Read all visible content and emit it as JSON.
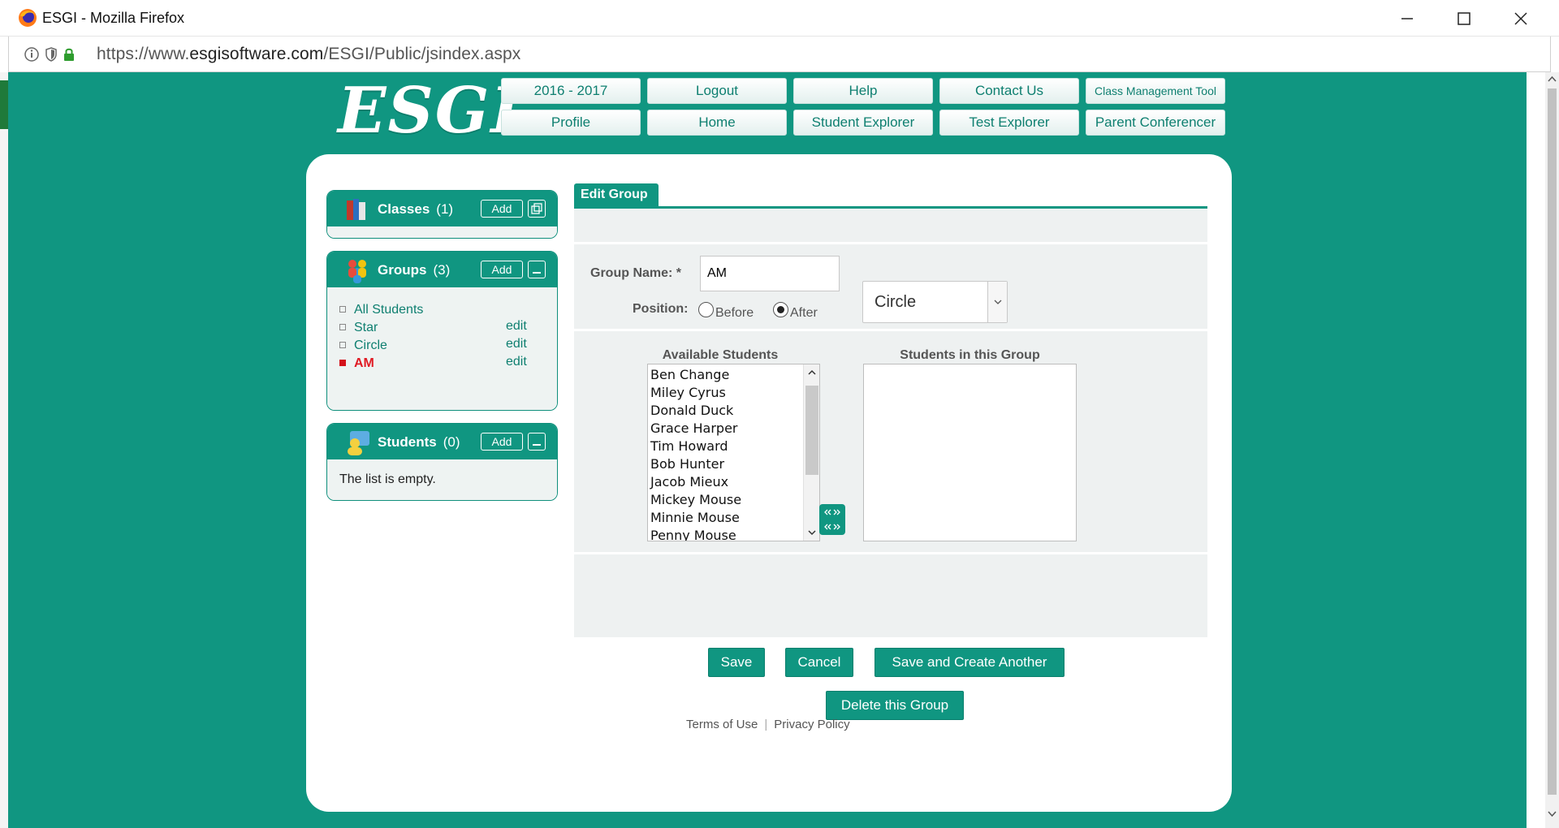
{
  "window": {
    "title": "ESGI - Mozilla Firefox",
    "url_prefix": "https://www.",
    "url_host": "esgisoftware.com",
    "url_path": "/ESGI/Public/jsindex.aspx"
  },
  "brand": {
    "logo_text": "ESGI"
  },
  "nav": {
    "row1": [
      "2016 - 2017",
      "Logout",
      "Help",
      "Contact Us",
      "Class Management Tool"
    ],
    "row2": [
      "Profile",
      "Home",
      "Student Explorer",
      "Test Explorer",
      "Parent Conferencer"
    ]
  },
  "sidebar": {
    "classes": {
      "title": "Classes",
      "count": "(1)",
      "add_label": "Add"
    },
    "groups": {
      "title": "Groups",
      "count": "(3)",
      "add_label": "Add",
      "items": [
        {
          "label": "All Students",
          "edit": ""
        },
        {
          "label": "Star",
          "edit": "edit"
        },
        {
          "label": "Circle",
          "edit": "edit"
        },
        {
          "label": "AM",
          "edit": "edit",
          "active": true
        }
      ]
    },
    "students": {
      "title": "Students",
      "count": "(0)",
      "add_label": "Add",
      "empty_text": "The list is empty."
    }
  },
  "edit_group": {
    "tab_label": "Edit Group",
    "group_name_label": "Group Name: *",
    "group_name_value": "AM",
    "position_label": "Position:",
    "before_label": "Before",
    "after_label": "After",
    "selected_position": "After",
    "position_select_value": "Circle",
    "available_title": "Available Students",
    "in_group_title": "Students in this Group",
    "available_students": [
      "Ben Change",
      "Miley Cyrus",
      "Donald Duck",
      "Grace Harper",
      "Tim Howard",
      "Bob Hunter",
      "Jacob Mieux",
      "Mickey Mouse",
      "Minnie Mouse",
      "Penny Mouse"
    ],
    "group_students": []
  },
  "actions": {
    "save": "Save",
    "cancel": "Cancel",
    "save_another": "Save and Create Another",
    "delete": "Delete this Group"
  },
  "footer": {
    "terms": "Terms of Use",
    "privacy": "Privacy Policy"
  },
  "colors": {
    "brand_teal": "#109681",
    "active_red": "#e01b24"
  }
}
